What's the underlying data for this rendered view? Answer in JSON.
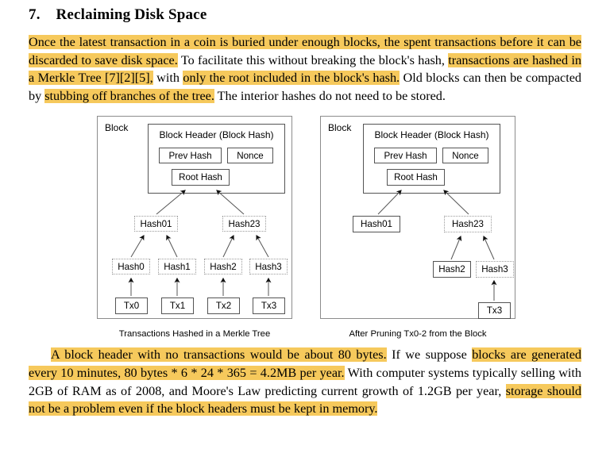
{
  "document": {
    "heading": {
      "number": "7.",
      "title": "Reclaiming Disk Space"
    },
    "paragraph_1": {
      "runs": [
        {
          "text": "Once the latest transaction in a coin is buried under enough blocks, the spent transactions before it can be discarded to save disk space.",
          "highlight": true
        },
        {
          "text": "  To facilitate this without breaking the block's hash, ",
          "highlight": false
        },
        {
          "text": "transactions are hashed in a Merkle Tree [7][2][5],",
          "highlight": true
        },
        {
          "text": " with ",
          "highlight": false
        },
        {
          "text": "only the root included in the block's hash.",
          "highlight": true
        },
        {
          "text": "  Old blocks can then be compacted by ",
          "highlight": false
        },
        {
          "text": "stubbing off branches of the tree.",
          "highlight": true
        },
        {
          "text": "  The interior hashes do not need to be stored.",
          "highlight": false
        }
      ]
    },
    "paragraph_2": {
      "runs": [
        {
          "text": "A block header with no transactions would be about 80 bytes.",
          "highlight": true
        },
        {
          "text": "  If we suppose ",
          "highlight": false
        },
        {
          "text": "blocks are generated every 10 minutes, 80 bytes * 6 * 24 * 365 = 4.2MB per year.",
          "highlight": true
        },
        {
          "text": "  With computer systems typically selling with 2GB of RAM as of 2008, and Moore's Law predicting current growth of 1.2GB per year, ",
          "highlight": false
        },
        {
          "text": "storage should not be a problem even if the block headers must be kept in memory.",
          "highlight": true
        }
      ]
    }
  },
  "figures": [
    {
      "id": "merkle-tree-full",
      "caption": "Transactions Hashed in a Merkle Tree",
      "block_label": "Block",
      "header_title": "Block Header (Block Hash)",
      "header_fields": [
        "Prev Hash",
        "Nonce"
      ],
      "root": "Root Hash",
      "inner_hashes": [
        "Hash01",
        "Hash23"
      ],
      "leaf_hashes": [
        "Hash0",
        "Hash1",
        "Hash2",
        "Hash3"
      ],
      "transactions": [
        "Tx0",
        "Tx1",
        "Tx2",
        "Tx3"
      ]
    },
    {
      "id": "merkle-tree-pruned",
      "caption": "After Pruning Tx0-2 from the Block",
      "block_label": "Block",
      "header_title": "Block Header (Block Hash)",
      "header_fields": [
        "Prev Hash",
        "Nonce"
      ],
      "root": "Root Hash",
      "inner_hashes": [
        "Hash01",
        "Hash23"
      ],
      "leaf_hashes": [
        "Hash2",
        "Hash3"
      ],
      "transactions": [
        "Tx3"
      ]
    }
  ],
  "colors": {
    "highlight": "#f6c95c",
    "box_border": "#545454",
    "outer_border": "#8c8c8c",
    "dotted_border": "#9a9a9a",
    "text": "#000000",
    "background": "#ffffff"
  }
}
